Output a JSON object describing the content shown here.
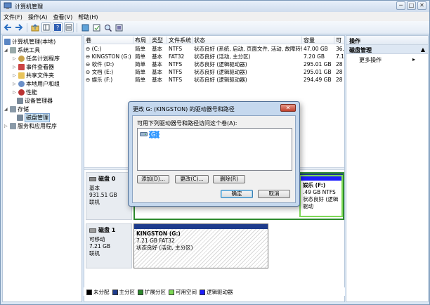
{
  "window": {
    "title": "计算机管理",
    "caption": {
      "minimize": "─",
      "maximize": "□",
      "close": "✕"
    }
  },
  "menu": [
    "文件(F)",
    "操作(A)",
    "查看(V)",
    "帮助(H)"
  ],
  "tree": {
    "root": "计算机管理(本地)",
    "system_tools": "系统工具",
    "items": [
      "任务计划程序",
      "事件查看器",
      "共享文件夹",
      "本地用户和组",
      "性能",
      "设备管理器"
    ],
    "storage": "存储",
    "disk_mgmt": "磁盘管理",
    "services": "服务和应用程序"
  },
  "volumes": {
    "headers": [
      "卷",
      "布局",
      "类型",
      "文件系统",
      "状态",
      "容量",
      "可"
    ],
    "rows": [
      {
        "name": "(C:)",
        "layout": "简单",
        "type": "基本",
        "fs": "NTFS",
        "status": "状态良好 (系统, 启动, 页面文件, 活动, 故障转储, 主分区)",
        "cap": "47.00 GB",
        "free": "36."
      },
      {
        "name": "KINGSTON (G:)",
        "layout": "简单",
        "type": "基本",
        "fs": "FAT32",
        "status": "状态良好 (活动, 主分区)",
        "cap": "7.20 GB",
        "free": "7.1"
      },
      {
        "name": "软件 (D:)",
        "layout": "简单",
        "type": "基本",
        "fs": "NTFS",
        "status": "状态良好 (逻辑驱动器)",
        "cap": "295.01 GB",
        "free": "28"
      },
      {
        "name": "文档 (E:)",
        "layout": "简单",
        "type": "基本",
        "fs": "NTFS",
        "status": "状态良好 (逻辑驱动器)",
        "cap": "295.01 GB",
        "free": "28"
      },
      {
        "name": "娱乐 (F:)",
        "layout": "简单",
        "type": "基本",
        "fs": "NTFS",
        "status": "状态良好 (逻辑驱动器)",
        "cap": "294.49 GB",
        "free": "28"
      }
    ]
  },
  "disk0": {
    "name": "磁盘 0",
    "type": "基本",
    "size": "931.51 GB",
    "state": "联机",
    "f_part": {
      "label": "娱乐 (F:)",
      "size": ".49 GB NTFS",
      "status": "状态良好 (逻辑驱动"
    }
  },
  "disk1": {
    "name": "磁盘 1",
    "type": "可移动",
    "size": "7.21 GB",
    "state": "联机",
    "part": {
      "label": "KINGSTON  (G:)",
      "size": "7.21 GB FAT32",
      "status": "状态良好 (活动, 主分区)"
    }
  },
  "legend": [
    {
      "label": "未分配",
      "color": "#000000"
    },
    {
      "label": "主分区",
      "color": "#1e3c8c"
    },
    {
      "label": "扩展分区",
      "color": "#2e8b2e"
    },
    {
      "label": "可用空间",
      "color": "#7ed957"
    },
    {
      "label": "逻辑驱动器",
      "color": "#1e1eff"
    }
  ],
  "actions": {
    "header": "操作",
    "section": "磁盘管理",
    "more": "更多操作"
  },
  "dialog": {
    "title": "更改 G: (KINGSTON) 的驱动器号和路径",
    "prompt": "可用下列驱动器号和路径访问这个卷(A):",
    "item": "G:",
    "add": "添加(D)...",
    "change": "更改(C)...",
    "remove": "删除(R)",
    "ok": "确定",
    "cancel": "取消"
  },
  "colors": {
    "primary": "#1e3c8c",
    "logical": "#1e1eff",
    "extended": "#2e8b2e",
    "free": "#7ed957"
  }
}
